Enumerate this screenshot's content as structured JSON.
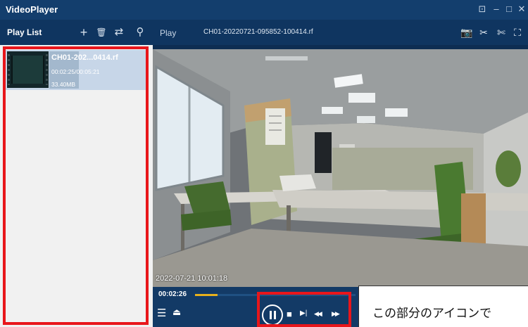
{
  "window": {
    "title": "VideoPlayer",
    "controls": [
      "⊡",
      "–",
      "□",
      "✕"
    ]
  },
  "playlist": {
    "header_label": "Play List",
    "tools": [
      "+",
      "🗑",
      "⇄",
      "⚲"
    ],
    "items": [
      {
        "name": "CH01-202...0414.rf",
        "time": "00:02:25/00:05:21",
        "size": "33.40MB"
      }
    ]
  },
  "player": {
    "header_label": "Play",
    "filename": "CH01-20220721-095852-100414.rf",
    "header_tools": [
      "📷",
      "✂",
      "✄",
      "⛶"
    ],
    "osd_timestamp": "2022-07-21 10:01:18",
    "current_time": "00:02:26",
    "progress_fraction": 0.14
  },
  "controls": {
    "playlist_toggle": "☰",
    "eject": "⏏",
    "stop": "■",
    "step": "▶|",
    "rewind": "◀◀",
    "forward": "▶▶"
  },
  "annotation": {
    "callout_text": "この部分のアイコンで",
    "accent_color": "#e8161b"
  }
}
